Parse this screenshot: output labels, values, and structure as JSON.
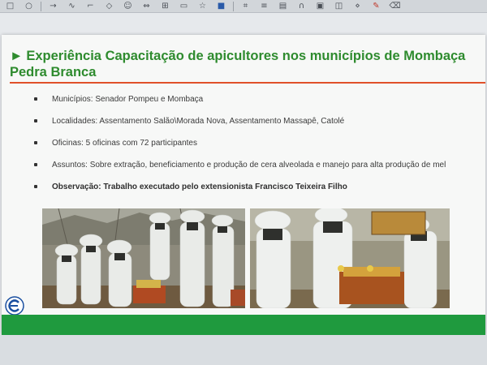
{
  "slide": {
    "title": "Experiência Capacitação de apicultores nos municípios de Mombaça Pedra Branca",
    "title_arrow": "►",
    "bullets": [
      "Municípios: Senador Pompeu e Mombaça",
      "Localidades: Assentamento Salão\\Morada Nova, Assentamento Massapê, Catolé",
      "Oficinas: 5 oficinas com 72 participantes",
      "Assuntos: Sobre extração, beneficiamento e produção de cera alveolada e manejo para alta produção de mel",
      "Observação: Trabalho executado pelo extensionista Francisco Teixeira Filho"
    ],
    "photos": [
      "beekeepers-group-photo",
      "beekeepers-inspecting-hive-photo"
    ]
  },
  "colors": {
    "title_green": "#2e8b2e",
    "rule_orange": "#e0502a",
    "footer_green": "#1f9a3e",
    "logo_blue": "#1a4fa0"
  },
  "toolbar": {
    "icons": [
      "square-icon",
      "circle-icon",
      "arrow-right-icon",
      "curve-icon",
      "connector-icon",
      "diamond-icon",
      "smiley-icon",
      "double-arrow-icon",
      "table-icon",
      "callout-icon",
      "star-icon",
      "dropdown-icon",
      "fill-color-icon",
      "dropdown-icon",
      "crop-icon",
      "align-icon",
      "shadow-icon",
      "magnet-icon",
      "wrap-icon",
      "group-icon",
      "effects-icon",
      "dropdown-icon",
      "pencil-icon",
      "eraser-icon",
      "more-icon"
    ]
  }
}
